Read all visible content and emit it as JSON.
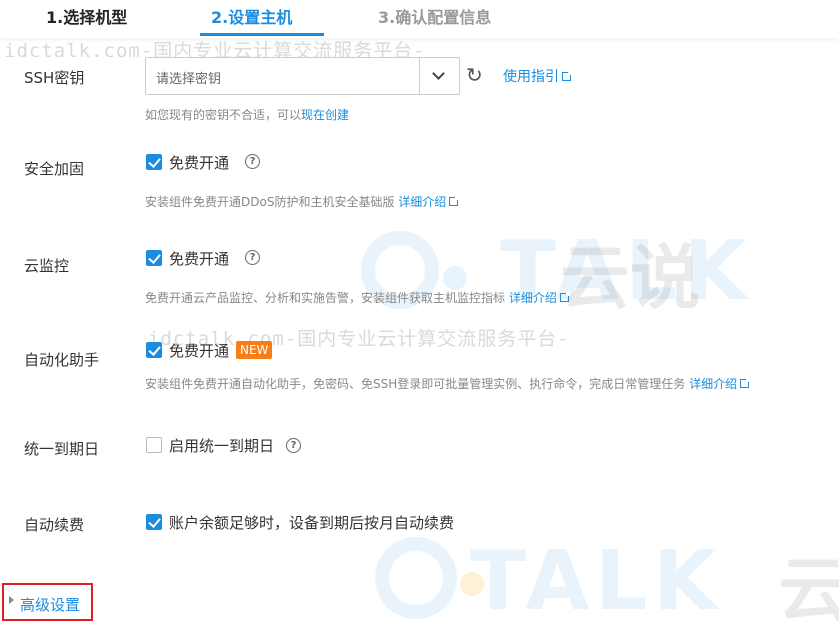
{
  "steps": {
    "step1": "1.选择机型",
    "step2": "2.设置主机",
    "step3": "3.确认配置信息"
  },
  "watermark": {
    "line": "idctalk.com-国内专业云计算交流服务平台-",
    "logo": "TALK",
    "logo_cn": "云说",
    "logo_cn2": "云"
  },
  "ssh": {
    "label": "SSH密钥",
    "placeholder": "请选择密钥",
    "guide_link": "使用指引",
    "hint_prefix": "如您现有的密钥不合适，可以",
    "hint_link": "现在创建"
  },
  "security": {
    "label": "安全加固",
    "checkbox": "免费开通",
    "checked": true,
    "hint": "安装组件免费开通DDoS防护和主机安全基础版",
    "link": "详细介绍"
  },
  "monitor": {
    "label": "云监控",
    "checkbox": "免费开通",
    "checked": true,
    "hint": "免费开通云产品监控、分析和实施告警，安装组件获取主机监控指标",
    "link": "详细介绍"
  },
  "assistant": {
    "label": "自动化助手",
    "checkbox": "免费开通",
    "badge": "NEW",
    "checked": true,
    "hint": "安装组件免费开通自动化助手，免密码、免SSH登录即可批量管理实例、执行命令，完成日常管理任务",
    "link": "详细介绍"
  },
  "expiry": {
    "label": "统一到期日",
    "checkbox": "启用统一到期日",
    "checked": false
  },
  "renew": {
    "label": "自动续费",
    "checkbox": "账户余额足够时，设备到期后按月自动续费",
    "checked": true
  },
  "advanced": {
    "label": "高级设置"
  },
  "colors": {
    "accent": "#1a8de0",
    "badge": "#f77e16",
    "highlight_border": "#e02020"
  }
}
